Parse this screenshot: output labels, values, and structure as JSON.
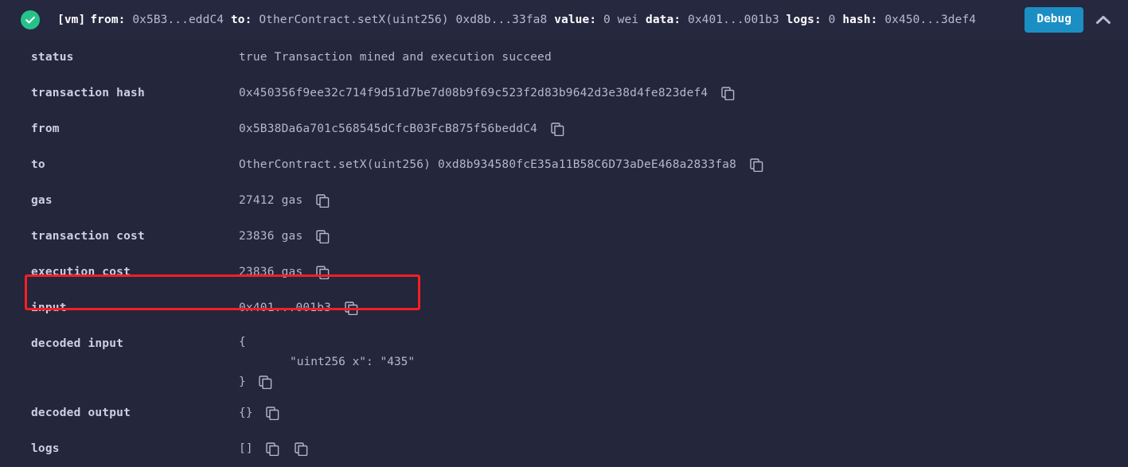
{
  "header": {
    "status_icon": "check-circle-icon",
    "summary": [
      {
        "key": "[vm]",
        "value": ""
      },
      {
        "key": "from:",
        "value": "0x5B3...eddC4"
      },
      {
        "key": "to:",
        "value": "OtherContract.setX(uint256) 0xd8b...33fa8"
      },
      {
        "key": "value:",
        "value": "0 wei"
      },
      {
        "key": "data:",
        "value": "0x401...001b3"
      },
      {
        "key": "logs:",
        "value": "0"
      },
      {
        "key": "hash:",
        "value": "0x450...3def4"
      }
    ],
    "debug_label": "Debug",
    "collapse_icon": "chevron-up-icon"
  },
  "rows": [
    {
      "label": "status",
      "value": "true Transaction mined and execution succeed",
      "copies": 0
    },
    {
      "label": "transaction hash",
      "value": "0x450356f9ee32c714f9d51d7be7d08b9f69c523f2d83b9642d3e38d4fe823def4",
      "copies": 1
    },
    {
      "label": "from",
      "value": "0x5B38Da6a701c568545dCfcB03FcB875f56beddC4",
      "copies": 1
    },
    {
      "label": "to",
      "value": "OtherContract.setX(uint256) 0xd8b934580fcE35a11B58C6D73aDeE468a2833fa8",
      "copies": 1
    },
    {
      "label": "gas",
      "value": "27412 gas",
      "copies": 1
    },
    {
      "label": "transaction cost",
      "value": "23836 gas",
      "copies": 1
    },
    {
      "label": "execution cost",
      "value": "23836 gas",
      "copies": 1
    },
    {
      "label": "input",
      "value": "0x401...001b3",
      "copies": 1,
      "highlighted": true
    }
  ],
  "decoded_input": {
    "label": "decoded input",
    "line_open": "{",
    "line_body": "\"uint256 x\": \"435\"",
    "line_close": "}",
    "copies": 1
  },
  "tail_rows": [
    {
      "label": "decoded output",
      "value": "{}",
      "copies": 1
    },
    {
      "label": "logs",
      "value": "[]",
      "copies": 2
    }
  ],
  "colors": {
    "background": "#24263c",
    "header_background": "#262840",
    "accent_button": "#1b8fc4",
    "status_success": "#27c28a",
    "highlight_border": "#f81f1f",
    "label_text": "#cdcfe3",
    "value_text": "#b5b7cd"
  }
}
